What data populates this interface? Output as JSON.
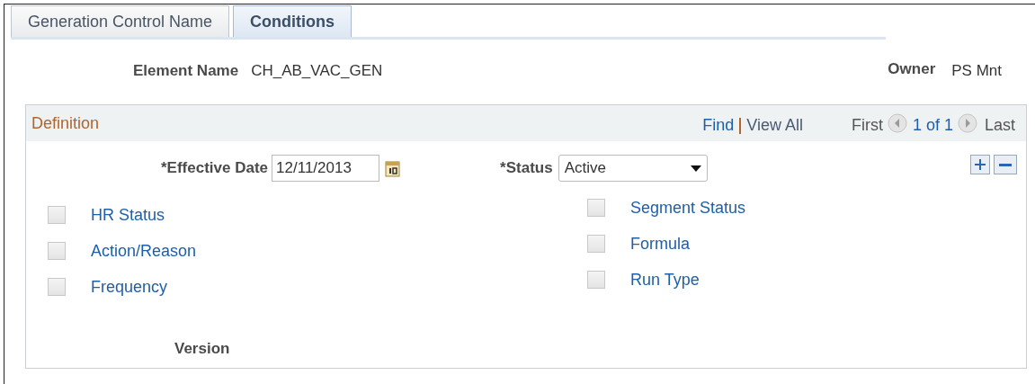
{
  "tabs": [
    {
      "label": "Generation Control Name",
      "selected": false
    },
    {
      "label": "Conditions",
      "selected": true
    }
  ],
  "header": {
    "element_label": "Element Name",
    "element_value": "CH_AB_VAC_GEN",
    "owner_label": "Owner",
    "owner_value": "PS Mnt"
  },
  "definition": {
    "title": "Definition",
    "find": "Find",
    "view_all": "View All",
    "first": "First",
    "count": "1 of 1",
    "last": "Last",
    "effective_date_label": "*Effective Date",
    "effective_date": "12/11/2013",
    "status_label": "*Status",
    "status": "Active",
    "left_checks": [
      {
        "label": "HR Status",
        "checked": false
      },
      {
        "label": "Action/Reason",
        "checked": false
      },
      {
        "label": "Frequency",
        "checked": false
      }
    ],
    "right_checks": [
      {
        "label": "Segment Status",
        "checked": false
      },
      {
        "label": "Formula",
        "checked": false
      },
      {
        "label": "Run Type",
        "checked": false
      }
    ],
    "version_label": "Version"
  }
}
